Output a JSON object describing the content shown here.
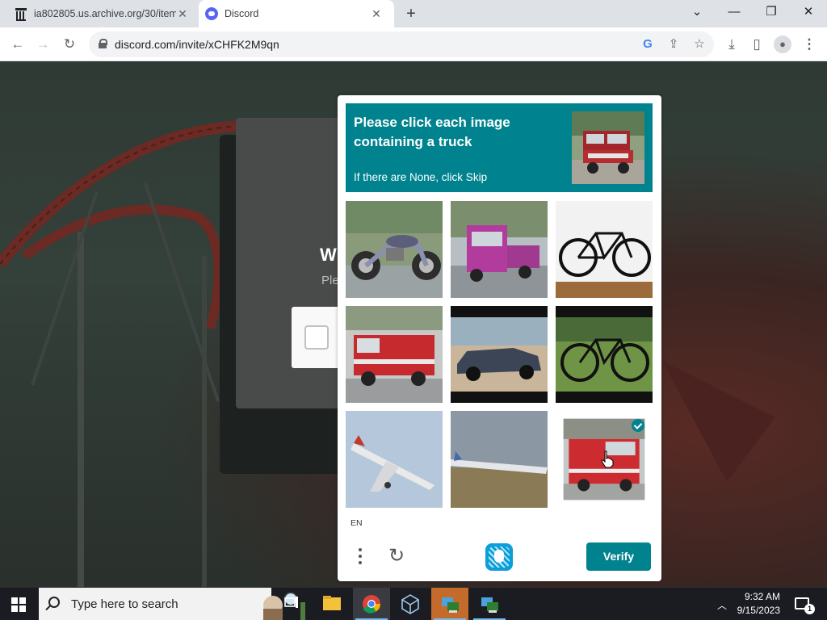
{
  "browser": {
    "tabs": [
      {
        "title": "ia802805.us.archive.org/30/items",
        "favicon": "archive-icon"
      },
      {
        "title": "Discord",
        "favicon": "discord-icon"
      }
    ],
    "new_tab": "+",
    "url": "discord.com/invite/xCHFK2M9qn"
  },
  "page": {
    "heading": "W",
    "subtext": "Ple"
  },
  "captcha": {
    "prompt_title": "Please click each image containing a truck",
    "prompt_subtitle": "If there are None, click Skip",
    "example_image": "red-truck",
    "grid": [
      {
        "subject": "motorcycle",
        "selected": false
      },
      {
        "subject": "pink-truck",
        "selected": false
      },
      {
        "subject": "bicycle",
        "selected": false
      },
      {
        "subject": "fire-truck",
        "selected": false
      },
      {
        "subject": "car",
        "selected": false
      },
      {
        "subject": "bicycle",
        "selected": false
      },
      {
        "subject": "airplane",
        "selected": false
      },
      {
        "subject": "airplane",
        "selected": false
      },
      {
        "subject": "fire-truck",
        "selected": true
      }
    ],
    "language": "EN",
    "verify_label": "Verify",
    "accent_color": "#00838f"
  },
  "taskbar": {
    "search_placeholder": "Type here to search",
    "time": "9:32 AM",
    "date": "9/15/2023",
    "notification_count": "1",
    "apps": [
      "task-view-icon",
      "file-explorer-icon",
      "chrome-icon",
      "virtualbox-icon",
      "network-app-icon",
      "network-app-icon"
    ]
  }
}
